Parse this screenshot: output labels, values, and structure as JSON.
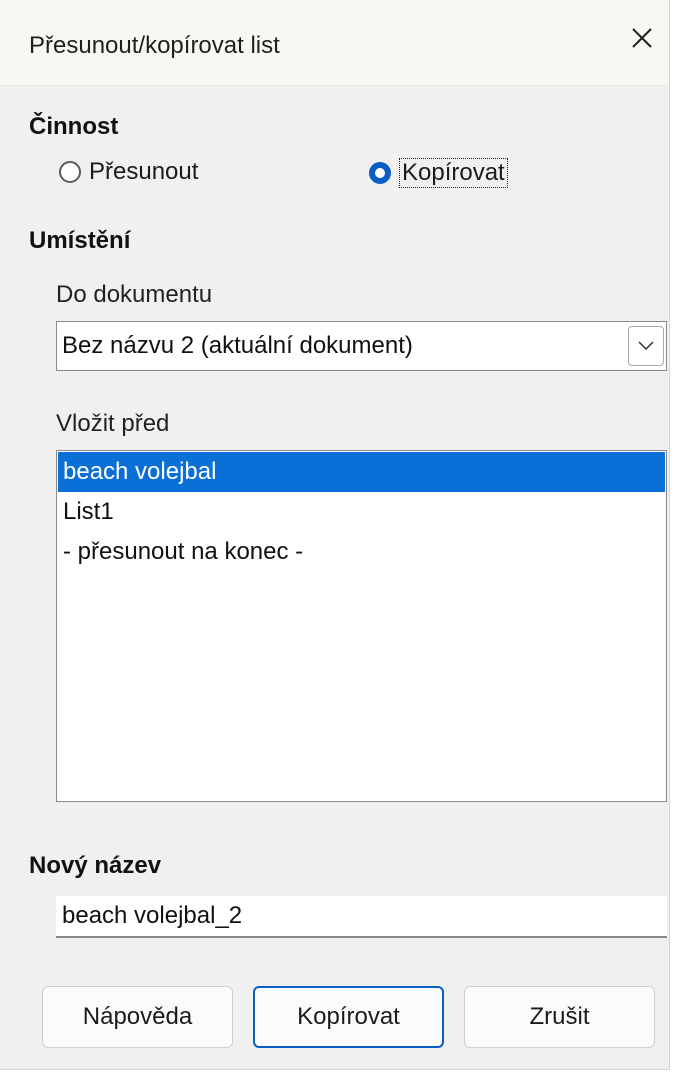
{
  "dialog": {
    "title": "Přesunout/kopírovat list",
    "close_icon": "close-icon"
  },
  "action": {
    "label": "Činnost",
    "options": [
      {
        "label": "Přesunout",
        "checked": false
      },
      {
        "label": "Kopírovat",
        "checked": true
      }
    ]
  },
  "location": {
    "label": "Umístění",
    "document_label": "Do dokumentu",
    "document_value": "Bez názvu 2 (aktuální dokument)",
    "insert_before_label": "Vložit před",
    "insert_before_items": [
      {
        "label": "beach volejbal",
        "selected": true
      },
      {
        "label": "List1",
        "selected": false
      },
      {
        "label": "- přesunout na konec -",
        "selected": false
      }
    ]
  },
  "new_name": {
    "label": "Nový název",
    "value": "beach volejbal_2"
  },
  "buttons": {
    "help": "Nápověda",
    "copy": "Kopírovat",
    "cancel": "Zrušit"
  },
  "colors": {
    "accent": "#0a5fc4",
    "selection": "#0a6fd6"
  }
}
